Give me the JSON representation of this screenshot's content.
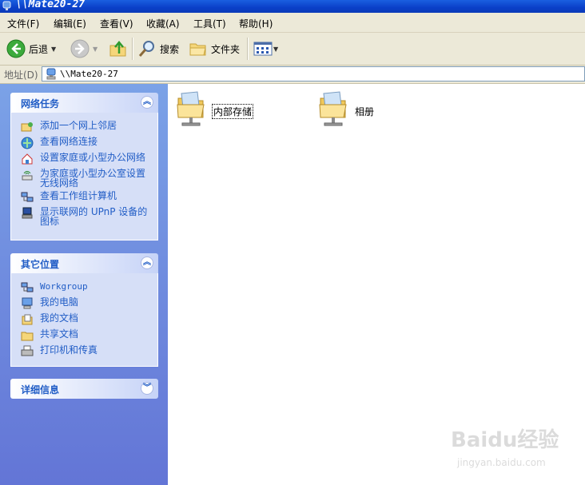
{
  "window": {
    "title": "\\\\Mate20-27"
  },
  "menu": [
    "文件(F)",
    "编辑(E)",
    "查看(V)",
    "收藏(A)",
    "工具(T)",
    "帮助(H)"
  ],
  "toolbar": {
    "back": "后退",
    "search": "搜索",
    "folders": "文件夹"
  },
  "address": {
    "label": "地址(D)",
    "value": "\\\\Mate20-27"
  },
  "network_tasks": {
    "title": "网络任务",
    "items": [
      {
        "label": "添加一个网上邻居",
        "icon": "add-network-place-icon"
      },
      {
        "label": "查看网络连接",
        "icon": "network-connections-icon"
      },
      {
        "label": "设置家庭或小型办公网络",
        "icon": "home-network-setup-icon"
      },
      {
        "label": "为家庭或小型办公室设置无线网络",
        "icon": "wireless-network-icon"
      },
      {
        "label": "查看工作组计算机",
        "icon": "workgroup-computers-icon"
      },
      {
        "label": "显示联网的 UPnP 设备的图标",
        "icon": "upnp-device-icon"
      }
    ]
  },
  "other_places": {
    "title": "其它位置",
    "items": [
      {
        "label": "Workgroup",
        "icon": "workgroup-icon"
      },
      {
        "label": "我的电脑",
        "icon": "my-computer-icon"
      },
      {
        "label": "我的文档",
        "icon": "my-documents-icon"
      },
      {
        "label": "共享文档",
        "icon": "shared-documents-icon"
      },
      {
        "label": "打印机和传真",
        "icon": "printers-fax-icon"
      }
    ]
  },
  "details": {
    "title": "详细信息"
  },
  "shares": [
    {
      "label": "内部存储",
      "selected": true
    },
    {
      "label": "相册",
      "selected": false
    }
  ],
  "watermark": {
    "text": "Baidu经验",
    "sub": "jingyan.baidu.com"
  }
}
